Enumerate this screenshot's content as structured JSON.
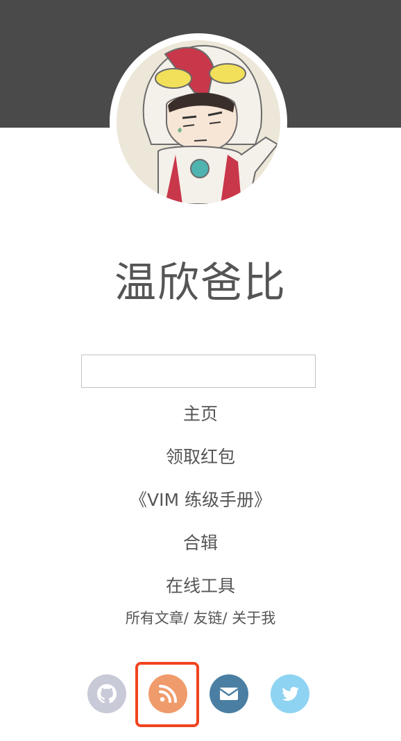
{
  "site": {
    "title": "温欣爸比"
  },
  "search": {
    "placeholder": "",
    "value": ""
  },
  "nav": {
    "items": [
      {
        "label": "主页"
      },
      {
        "label": "领取红包"
      },
      {
        "label": "《VIM 练级手册》"
      },
      {
        "label": "合辑"
      },
      {
        "label": "在线工具"
      }
    ]
  },
  "sub_links": {
    "all_posts": "所有文章",
    "friends": "友链",
    "about": "关于我",
    "separator": "/ "
  },
  "social": {
    "items": [
      {
        "icon": "github-icon",
        "color": "#c8cad8"
      },
      {
        "icon": "rss-icon",
        "color": "#f09b6c"
      },
      {
        "icon": "mail-icon",
        "color": "#4a7fa3"
      },
      {
        "icon": "twitter-icon",
        "color": "#8fd3f2"
      }
    ],
    "highlight_color": "#f2431f"
  },
  "colors": {
    "header_band": "#4a4a4a",
    "text": "#555555"
  }
}
